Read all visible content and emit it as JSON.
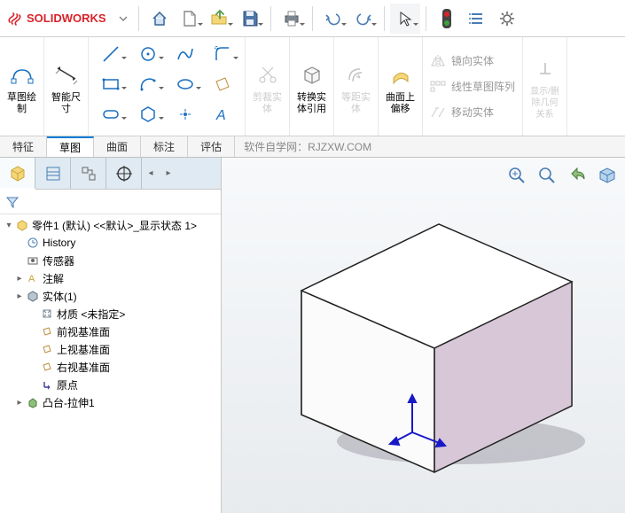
{
  "app": {
    "name": "SOLIDWORKS"
  },
  "toolbar": {
    "home": "home",
    "new": "new",
    "open": "open",
    "save": "save",
    "print": "print",
    "undo": "undo",
    "redo": "redo",
    "select": "select"
  },
  "ribbon": {
    "sketch_draw": "草图绘\n制",
    "smart_dim": "智能尺\n寸",
    "trim": "剪裁实\n体",
    "convert": "转换实\n体引用",
    "offset": "等距实\n体",
    "surface_offset": "曲面上\n偏移",
    "mirror": "镜向实体",
    "pattern": "线性草图阵列",
    "move": "移动实体",
    "display_rel": "显示/删\n除几何\n关系"
  },
  "tabs": {
    "items": [
      "特征",
      "草图",
      "曲面",
      "标注",
      "评估"
    ],
    "active": 1,
    "watermark": "软件自学网：RJZXW.COM"
  },
  "tree": {
    "root": "零件1 (默认) <<默认>_显示状态 1>",
    "items": [
      {
        "label": "History",
        "icon": "history"
      },
      {
        "label": "传感器",
        "icon": "sensor"
      },
      {
        "label": "注解",
        "icon": "annot",
        "expandable": true
      },
      {
        "label": "实体(1)",
        "icon": "solid",
        "expandable": true
      },
      {
        "label": "材质 <未指定>",
        "icon": "material",
        "indent": 1
      },
      {
        "label": "前视基准面",
        "icon": "plane",
        "indent": 1
      },
      {
        "label": "上视基准面",
        "icon": "plane",
        "indent": 1
      },
      {
        "label": "右视基准面",
        "icon": "plane",
        "indent": 1
      },
      {
        "label": "原点",
        "icon": "origin",
        "indent": 1
      },
      {
        "label": "凸台-拉伸1",
        "icon": "extrude",
        "expandable": true
      }
    ]
  }
}
